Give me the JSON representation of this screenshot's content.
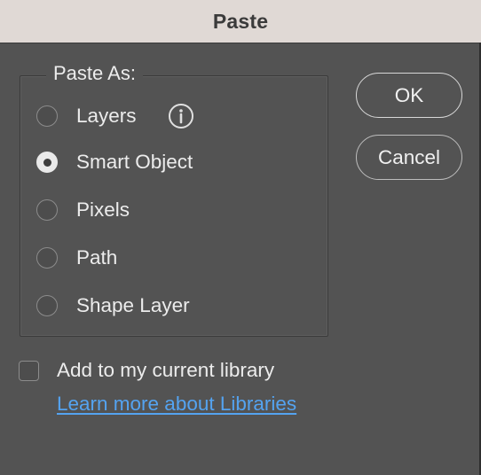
{
  "window": {
    "title": "Paste"
  },
  "paste_as": {
    "legend": "Paste As:",
    "options": [
      {
        "label": "Layers",
        "selected": false
      },
      {
        "label": "Smart Object",
        "selected": true
      },
      {
        "label": "Pixels",
        "selected": false
      },
      {
        "label": "Path",
        "selected": false
      },
      {
        "label": "Shape Layer",
        "selected": false
      }
    ],
    "info_icon": "info-circle-icon"
  },
  "buttons": {
    "ok_label": "OK",
    "cancel_label": "Cancel"
  },
  "library": {
    "checkbox_label": "Add to my current library",
    "checked": false,
    "link_text": "Learn more about Libraries"
  },
  "colors": {
    "dialog_bg": "#535353",
    "titlebar_bg": "#e0d9d5",
    "link": "#54a3f0"
  }
}
